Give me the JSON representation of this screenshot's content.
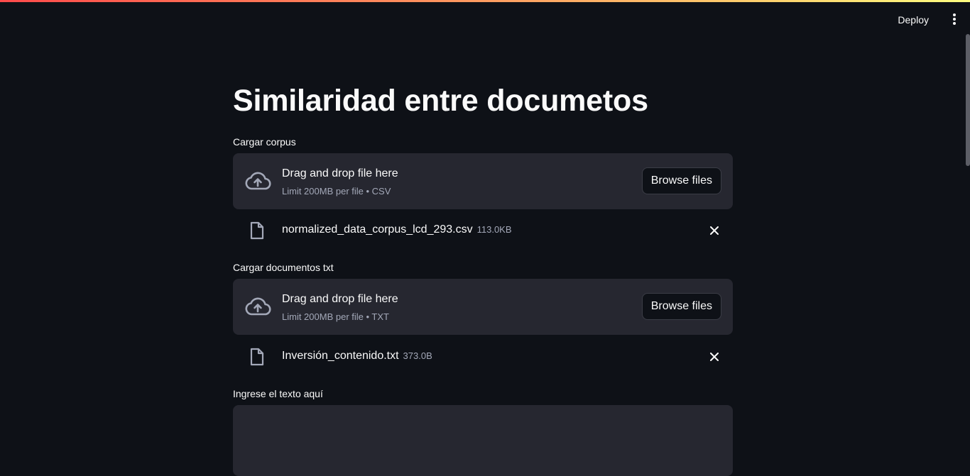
{
  "header": {
    "deploy_label": "Deploy",
    "menu_icon": "vertical-ellipsis-icon"
  },
  "page": {
    "title": "Similaridad entre documetos"
  },
  "corpus_uploader": {
    "label": "Cargar corpus",
    "drop_text": "Drag and drop file here",
    "limit_text": "Limit 200MB per file • CSV",
    "browse_label": "Browse files",
    "file": {
      "name": "normalized_data_corpus_lcd_293.csv",
      "size": "113.0KB"
    }
  },
  "txt_uploader": {
    "label": "Cargar documentos txt",
    "drop_text": "Drag and drop file here",
    "limit_text": "Limit 200MB per file • TXT",
    "browse_label": "Browse files",
    "file": {
      "name": "Inversión_contenido.txt",
      "size": "373.0B"
    }
  },
  "text_input": {
    "label": "Ingrese el texto aquí",
    "value": ""
  },
  "colors": {
    "background": "#0e1117",
    "surface": "#262730",
    "text": "#fafafa",
    "muted": "#a3a8b8",
    "accent_gradient_start": "#ff4b4b",
    "accent_gradient_end": "#fffd80"
  }
}
